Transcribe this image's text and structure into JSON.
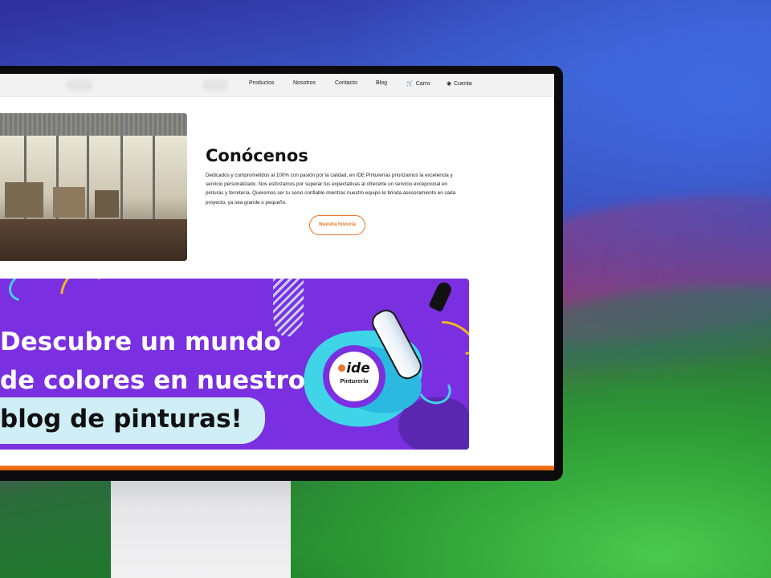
{
  "nav": {
    "links": [
      {
        "label": "Productos"
      },
      {
        "label": "Nosotros"
      },
      {
        "label": "Contacto"
      },
      {
        "label": "Blog"
      },
      {
        "label": "Carro",
        "icon": "cart-icon"
      },
      {
        "label": "Cuenta",
        "icon": "user-icon"
      }
    ]
  },
  "about": {
    "title": "Conócenos",
    "text": "Dedicados y comprometidos al 100% con pasión por la calidad, en IDE Pinturerías priorizamos la excelencia y servicio personalizado. Nos esforzamos por superar tus expectativas al ofrecerte un servicio excepcional en pinturas y ferretería. Queremos ser tu socio confiable mientras nuestro equipo te brinda asesoramiento en cada proyecto, ya sea grande o pequeño.",
    "button_label": "Nuestra historia"
  },
  "banner": {
    "line1": "Descubre un mundo",
    "line2": "de colores en nuestro",
    "line3": "blog de pinturas!",
    "logo_text": "ide",
    "logo_subtext": "Pinturería"
  },
  "colors": {
    "accent": "#e8772a",
    "banner_bg": "#7a2fe0",
    "splash": "#3fd4e8"
  }
}
